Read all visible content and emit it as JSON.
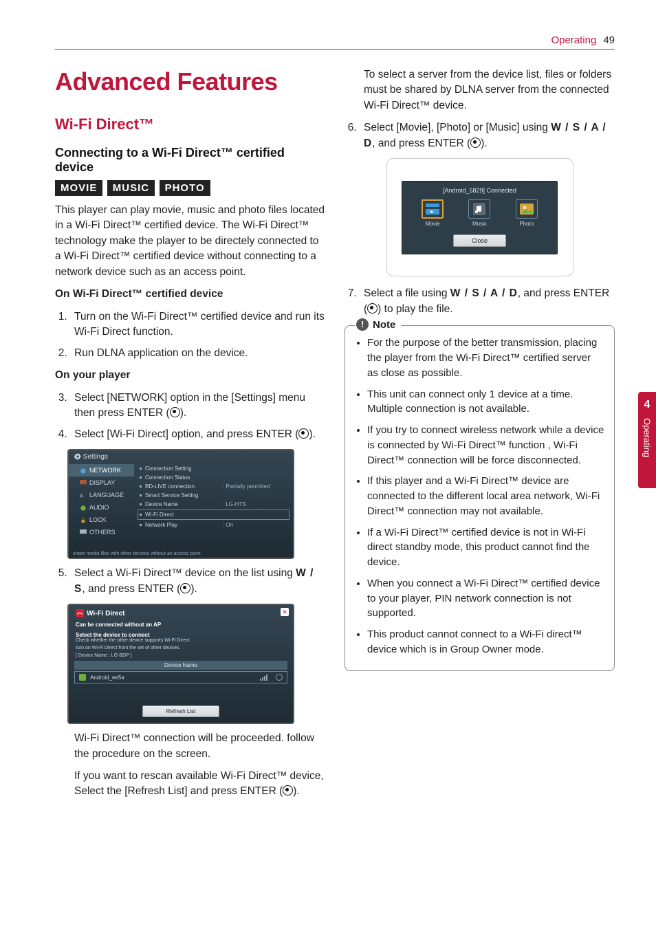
{
  "header": {
    "section": "Operating",
    "page": "49"
  },
  "side_tab": {
    "number": "4",
    "label": "Operating"
  },
  "title": "Advanced Features",
  "h2": "Wi-Fi Direct™",
  "h3": "Connecting to a Wi-Fi Direct™ certified device",
  "modes": {
    "movie": "MOVIE",
    "music": "MUSIC",
    "photo": "PHOTO"
  },
  "intro": "This player can play movie, music and photo files located in a Wi-Fi Direct™ certified device. The Wi-Fi Direct™ technology make the player to be directely connected to a Wi-Fi Direct™ certified device without connecting to a network device such as an access point.",
  "sub1": "On Wi-Fi Direct™ certified device",
  "step1": "Turn on the Wi-Fi Direct™ certified device and run its Wi-Fi Direct function.",
  "step2": "Run DLNA application on the device.",
  "sub2": "On your player",
  "step3_a": "Select [NETWORK] option in the [Settings] menu then press ENTER (",
  "step3_b": ").",
  "step4_a": "Select [Wi-Fi Direct] option, and press ENTER (",
  "step4_b": ").",
  "ss1": {
    "title": "Settings",
    "menu": {
      "network": "NETWORK",
      "display": "DISPLAY",
      "language": "LANGUAGE",
      "audio": "AUDIO",
      "lock": "LOCK",
      "others": "OTHERS"
    },
    "rows": {
      "conn_setting": "Connection Setting",
      "conn_status": "Connection Status",
      "bdlive": "BD-LIVE connection",
      "bdlive_v": ": Partially permitted",
      "smart": "Smart Service Setting",
      "devname": "Device Name",
      "devname_v": ": LG-HTS",
      "wifidirect": "Wi-Fi Direct",
      "netplay": "Network Play",
      "netplay_v": ": On"
    },
    "footer": "share media files with other devices without an access point"
  },
  "step5_a": "Select a Wi-Fi Direct™ device on the list using ",
  "step5_nav": "W / S",
  "step5_b": ", and press ENTER (",
  "step5_c": ").",
  "ss2": {
    "title": "Wi-Fi Direct",
    "line1": "Can be connected without an AP",
    "line2": "Select the device to connect",
    "line3a": "Check whether the other device supports Wi-Fi Direct",
    "line3b": "turn on Wi-Fi Direct from the set of other devices.",
    "line3c": "[ Device Name : LG-BDP ]",
    "thead": "Device Name",
    "device": "Android_ee5a",
    "refresh": "Refresh List"
  },
  "after5a": "Wi-Fi Direct™ connection will be proceeded. follow the procedure on the screen.",
  "after5b_a": "If you want to rescan available Wi-Fi Direct™ device, Select the [Refresh List] and press ENTER (",
  "after5b_b": ").",
  "right_intro": "To select a server from the device list, files or folders must be shared by DLNA server from the connected Wi-Fi Direct™ device.",
  "step6_a": "Select [Movie], [Photo] or [Music] using ",
  "step6_nav": "W / S / A / D",
  "step6_b": ", and press ENTER (",
  "step6_c": ").",
  "ss3": {
    "title": "[Android_5829] Connected",
    "movie": "Movie",
    "music": "Music",
    "photo": "Photo",
    "close": "Close"
  },
  "step7_a": "Select a file using ",
  "step7_nav": "W / S / A / D",
  "step7_b": ", and press ENTER (",
  "step7_c": ") to play the file.",
  "note": {
    "label": "Note",
    "items": [
      "For the purpose of the better transmission, placing the player from the Wi-Fi Direct™ certified server as close as possible.",
      "This unit can connect only 1 device at a time. Multiple connection is not available.",
      "If you try to connect wireless network while a device is connected by Wi-Fi Direct™ function , Wi-Fi Direct™ connection will be force disconnected.",
      "If this player and a Wi-Fi Direct™ device are connected to the different local area network, Wi-Fi Direct™ connection may not available.",
      "If a Wi-Fi Direct™ certified device is not in Wi-Fi direct standby mode, this product cannot find the device.",
      "When you connect a Wi-Fi Direct™ certified device to your player, PIN network connection is not supported.",
      "This product cannot connect to a Wi-Fi direct™ device which is in Group Owner mode."
    ]
  }
}
